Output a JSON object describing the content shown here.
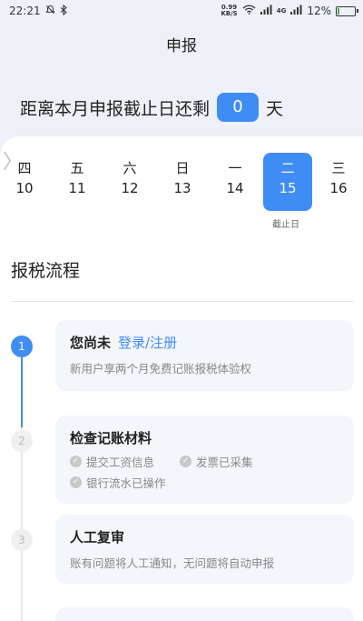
{
  "status_bar": {
    "time": "22:21",
    "net_speed_value": "0.99",
    "net_speed_unit": "KB/S",
    "signal_label": "4G",
    "battery_percent": "12%",
    "battery_level": 0.12
  },
  "header": {
    "title": "申报"
  },
  "deadline": {
    "prefix": "距离本月申报截止日还剩",
    "count": "0",
    "suffix": "天"
  },
  "calendar": {
    "days": [
      {
        "weekday": "四",
        "date": "10"
      },
      {
        "weekday": "五",
        "date": "11"
      },
      {
        "weekday": "六",
        "date": "12"
      },
      {
        "weekday": "日",
        "date": "13"
      },
      {
        "weekday": "一",
        "date": "14"
      },
      {
        "weekday": "二",
        "date": "15"
      },
      {
        "weekday": "三",
        "date": "16"
      }
    ],
    "selected_index": 5,
    "deadline_label": "截止日"
  },
  "process": {
    "title": "报税流程",
    "steps": [
      {
        "number": "1",
        "title": "您尚未",
        "link": "登录/注册",
        "subtitle": "新用户享两个月免费记账报税体验权"
      },
      {
        "number": "2",
        "title": "检查记账材料",
        "checks": [
          "提交工资信息",
          "发票已采集",
          "银行流水已操作"
        ]
      },
      {
        "number": "3",
        "title": "人工复审",
        "subtitle": "账有问题将人工通知，无问题将自动申报"
      }
    ]
  }
}
